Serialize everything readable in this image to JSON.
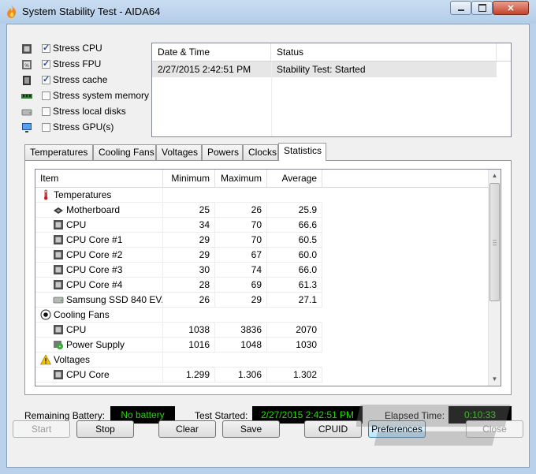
{
  "window": {
    "title": "System Stability Test - AIDA64",
    "controls": [
      "minimize",
      "maximize",
      "close"
    ]
  },
  "stress_options": [
    {
      "label": "Stress CPU",
      "checked": true,
      "icon": "cpu-chip-icon"
    },
    {
      "label": "Stress FPU",
      "checked": true,
      "icon": "fpu-chip-icon"
    },
    {
      "label": "Stress cache",
      "checked": true,
      "icon": "cache-chip-icon"
    },
    {
      "label": "Stress system memory",
      "checked": false,
      "icon": "memory-module-icon"
    },
    {
      "label": "Stress local disks",
      "checked": false,
      "icon": "disk-drive-icon"
    },
    {
      "label": "Stress GPU(s)",
      "checked": false,
      "icon": "monitor-icon"
    }
  ],
  "log": {
    "columns": [
      "Date & Time",
      "Status"
    ],
    "rows": [
      {
        "datetime": "2/27/2015 2:42:51 PM",
        "status": "Stability Test: Started"
      }
    ]
  },
  "tabs": [
    "Temperatures",
    "Cooling Fans",
    "Voltages",
    "Powers",
    "Clocks",
    "Statistics"
  ],
  "active_tab": "Statistics",
  "stats": {
    "columns": [
      "Item",
      "Minimum",
      "Maximum",
      "Average"
    ],
    "rows": [
      {
        "group": true,
        "item": "Temperatures",
        "icon": "thermometer-icon"
      },
      {
        "item": "Motherboard",
        "min": "25",
        "max": "26",
        "avg": "25.9",
        "icon": "motherboard-icon"
      },
      {
        "item": "CPU",
        "min": "34",
        "max": "70",
        "avg": "66.6",
        "icon": "cpu-icon"
      },
      {
        "item": "CPU Core #1",
        "min": "29",
        "max": "70",
        "avg": "60.5",
        "icon": "cpu-icon"
      },
      {
        "item": "CPU Core #2",
        "min": "29",
        "max": "67",
        "avg": "60.0",
        "icon": "cpu-icon"
      },
      {
        "item": "CPU Core #3",
        "min": "30",
        "max": "74",
        "avg": "66.0",
        "icon": "cpu-icon"
      },
      {
        "item": "CPU Core #4",
        "min": "28",
        "max": "69",
        "avg": "61.3",
        "icon": "cpu-icon"
      },
      {
        "item": "Samsung SSD 840 EV...",
        "min": "26",
        "max": "29",
        "avg": "27.1",
        "icon": "disk-drive-icon"
      },
      {
        "group": true,
        "item": "Cooling Fans",
        "icon": "fan-icon"
      },
      {
        "item": "CPU",
        "min": "1038",
        "max": "3836",
        "avg": "2070",
        "icon": "cpu-icon"
      },
      {
        "item": "Power Supply",
        "min": "1016",
        "max": "1048",
        "avg": "1030",
        "icon": "power-supply-icon"
      },
      {
        "group": true,
        "item": "Voltages",
        "icon": "warning-icon"
      },
      {
        "item": "CPU Core",
        "min": "1.299",
        "max": "1.306",
        "avg": "1.302",
        "icon": "cpu-icon"
      }
    ]
  },
  "status": {
    "battery_label": "Remaining Battery:",
    "battery_value": "No battery",
    "started_label": "Test Started:",
    "started_value": "2/27/2015 2:42:51 PM",
    "elapsed_label": "Elapsed Time:",
    "elapsed_value": "0:10:33"
  },
  "buttons": {
    "start": "Start",
    "stop": "Stop",
    "clear": "Clear",
    "save": "Save",
    "cpuid": "CPUID",
    "preferences": "Preferences",
    "close": "Close"
  },
  "colors": {
    "lcd_bg": "#000000",
    "lcd_text": "#22d800",
    "window_frame": "#b9d1ea"
  }
}
